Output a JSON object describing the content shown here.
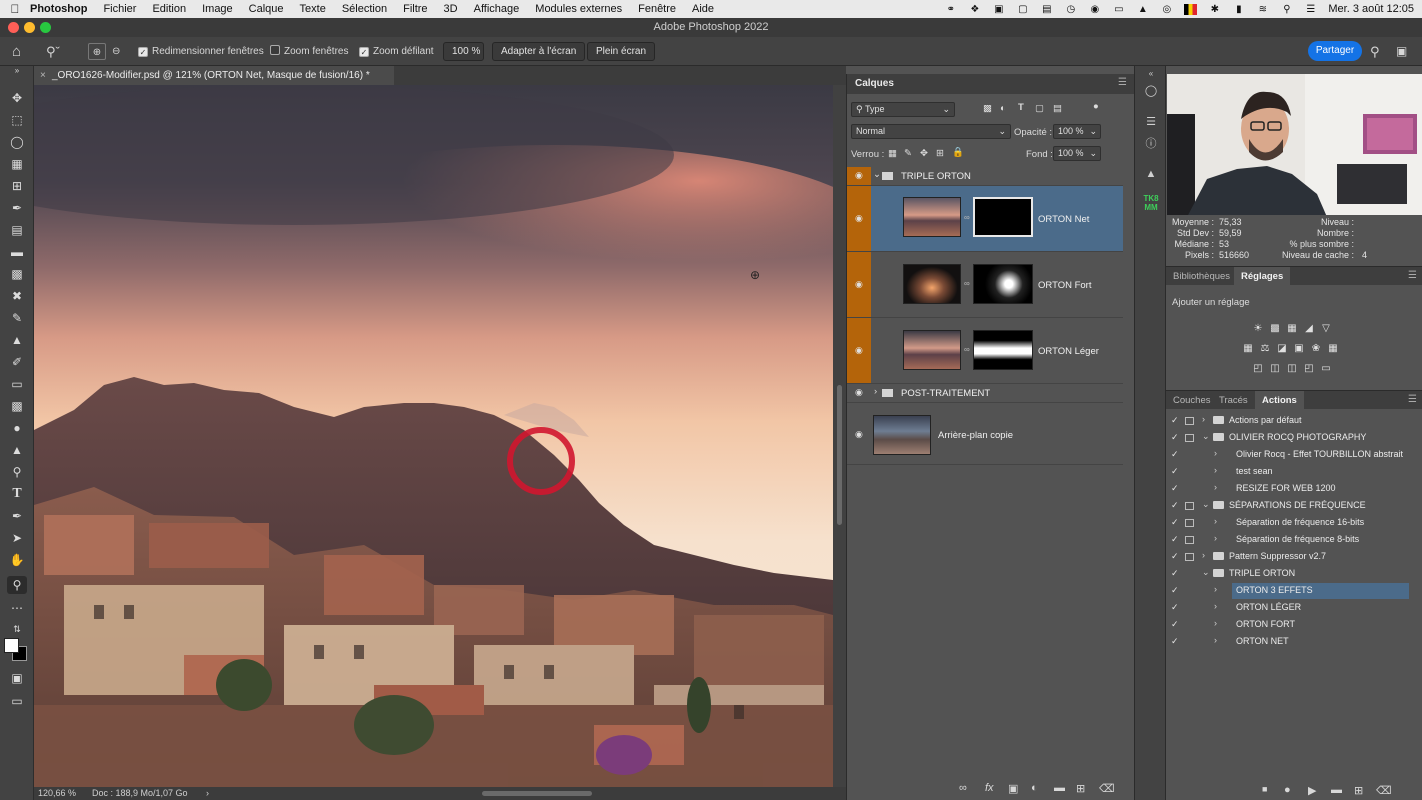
{
  "menubar": {
    "app": "Photoshop",
    "items": [
      "Fichier",
      "Edition",
      "Image",
      "Calque",
      "Texte",
      "Sélection",
      "Filtre",
      "3D",
      "Affichage",
      "Modules externes",
      "Fenêtre",
      "Aide"
    ],
    "clock": "Mer. 3 août  12:05"
  },
  "window": {
    "title": "Adobe Photoshop 2022"
  },
  "options": {
    "resize_windows": "Redimensionner fenêtres",
    "zoom_windows": "Zoom fenêtres",
    "scrubby_zoom": "Zoom défilant",
    "zoom_value": "100 %",
    "fit_screen": "Adapter à l'écran",
    "full_screen": "Plein écran",
    "share": "Partager"
  },
  "document": {
    "tab_title": "_ORO1626-Modifier.psd @ 121% (ORTON Net, Masque de fusion/16) *",
    "zoom": "120,66 %",
    "doc_size": "Doc : 188,9 Mo/1,07 Go"
  },
  "layers": {
    "panel_title": "Calques",
    "filter_type": "Type",
    "blend_mode": "Normal",
    "opacity_label": "Opacité :",
    "opacity_value": "100 %",
    "lock_label": "Verrou :",
    "fill_label": "Fond :",
    "fill_value": "100 %",
    "items": [
      {
        "name": "TRIPLE ORTON",
        "kind": "group"
      },
      {
        "name": "ORTON Net",
        "kind": "layer"
      },
      {
        "name": "ORTON Fort",
        "kind": "layer"
      },
      {
        "name": "ORTON Léger",
        "kind": "layer"
      },
      {
        "name": "POST-TRAITEMENT",
        "kind": "group"
      },
      {
        "name": "Arrière-plan copie",
        "kind": "layer"
      }
    ]
  },
  "histogram": {
    "mean_label": "Moyenne :",
    "mean": "75,33",
    "std_label": "Std Dev :",
    "std": "59,59",
    "median_label": "Médiane :",
    "median": "53",
    "pixels_label": "Pixels :",
    "pixels": "516660",
    "level_label": "Niveau :",
    "count_label": "Nombre :",
    "percentile_label": "% plus sombre :",
    "cache_label": "Niveau de cache :",
    "cache": "4"
  },
  "library_tabs": {
    "libraries": "Bibliothèques",
    "adjustments": "Réglages"
  },
  "adjustments": {
    "add_label": "Ajouter un réglage"
  },
  "actions_tabs": {
    "channels": "Couches",
    "paths": "Tracés",
    "actions": "Actions"
  },
  "actions": [
    {
      "name": "Actions par défaut",
      "level": 0,
      "type": "set",
      "open": false,
      "dialog": true
    },
    {
      "name": "OLIVIER ROCQ PHOTOGRAPHY",
      "level": 0,
      "type": "set",
      "open": true,
      "dialog": true
    },
    {
      "name": "Olivier Rocq - Effet TOURBILLON abstrait",
      "level": 1,
      "type": "action",
      "open": false,
      "dialog": false
    },
    {
      "name": "test sean",
      "level": 1,
      "type": "action",
      "open": false,
      "dialog": false
    },
    {
      "name": "RESIZE FOR WEB 1200",
      "level": 1,
      "type": "action",
      "open": false,
      "dialog": false
    },
    {
      "name": "SÉPARATIONS DE FRÉQUENCE",
      "level": 0,
      "type": "set",
      "open": true,
      "dialog": true
    },
    {
      "name": "Séparation de fréquence 16-bits",
      "level": 1,
      "type": "action",
      "open": false,
      "dialog": true
    },
    {
      "name": "Séparation de fréquence 8-bits",
      "level": 1,
      "type": "action",
      "open": false,
      "dialog": true
    },
    {
      "name": "Pattern Suppressor v2.7",
      "level": 0,
      "type": "set",
      "open": false,
      "dialog": true
    },
    {
      "name": "TRIPLE ORTON",
      "level": 0,
      "type": "set",
      "open": true,
      "dialog": false
    },
    {
      "name": "ORTON 3 EFFETS",
      "level": 1,
      "type": "action",
      "open": false,
      "dialog": false,
      "selected": true
    },
    {
      "name": "ORTON LÉGER",
      "level": 1,
      "type": "action",
      "open": false,
      "dialog": false
    },
    {
      "name": "ORTON FORT",
      "level": 1,
      "type": "action",
      "open": false,
      "dialog": false
    },
    {
      "name": "ORTON NET",
      "level": 1,
      "type": "action",
      "open": false,
      "dialog": false
    }
  ],
  "colors": {
    "accent": "#1473e6",
    "group_color": "#b4640a",
    "selection": "#4b6b8a",
    "cursor_ring": "#d0162f"
  }
}
